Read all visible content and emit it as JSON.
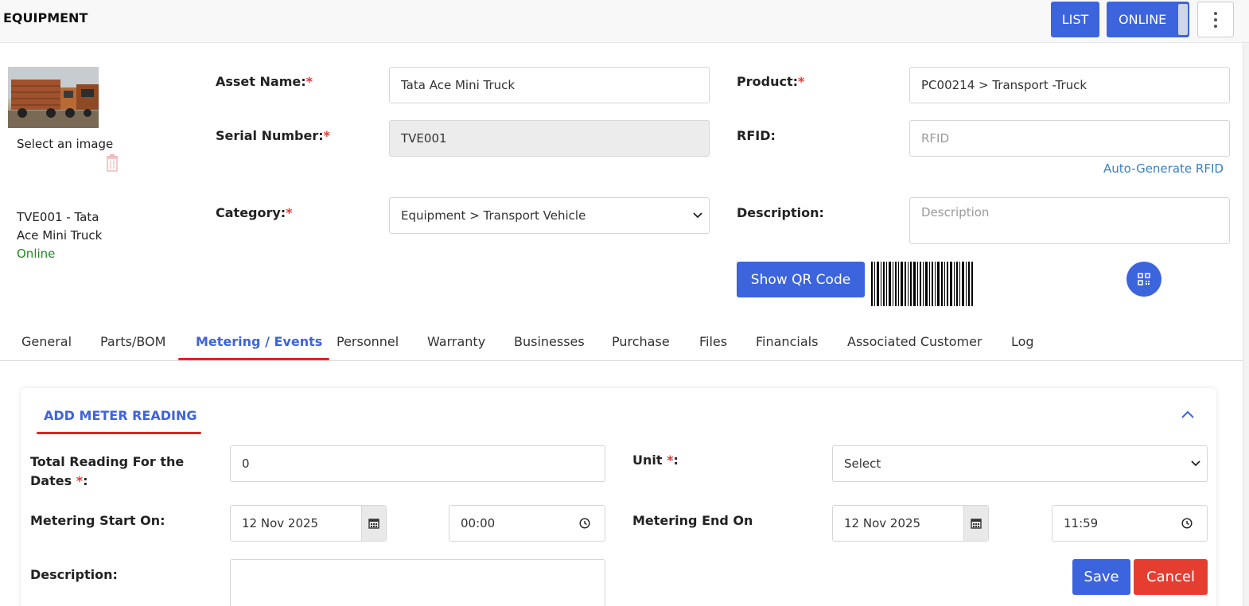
{
  "header": {
    "title": "EQUIPMENT",
    "list_label": "LIST",
    "online_label": "ONLINE"
  },
  "asset": {
    "select_image_label": "Select an image",
    "summary_line1": "TVE001 - Tata",
    "summary_line2": "Ace Mini Truck",
    "status": "Online"
  },
  "form": {
    "asset_name_label": "Asset Name:",
    "asset_name_value": "Tata Ace Mini Truck",
    "serial_label": "Serial Number:",
    "serial_value": "TVE001",
    "category_label": "Category:",
    "category_value": "Equipment > Transport Vehicle",
    "product_label": "Product:",
    "product_value": "PC00214 > Transport -Truck",
    "rfid_label": "RFID:",
    "rfid_placeholder": "RFID",
    "auto_rfid_link": "Auto-Generate RFID",
    "description_label": "Description:",
    "description_placeholder": "Description",
    "show_qr_label": "Show QR Code",
    "required_mark": "*"
  },
  "tabs": [
    {
      "label": "General"
    },
    {
      "label": "Parts/BOM"
    },
    {
      "label": "Metering / Events"
    },
    {
      "label": "Personnel"
    },
    {
      "label": "Warranty"
    },
    {
      "label": "Businesses"
    },
    {
      "label": "Purchase"
    },
    {
      "label": "Files"
    },
    {
      "label": "Financials"
    },
    {
      "label": "Associated Customer"
    },
    {
      "label": "Log"
    }
  ],
  "active_tab": "Metering / Events",
  "meter": {
    "title": "ADD METER READING",
    "total_label_line1": "Total Reading For the",
    "total_label_line2": "Dates",
    "total_value": "0",
    "unit_label": "Unit",
    "unit_value": "Select",
    "start_label": "Metering Start On:",
    "start_date": "12 Nov 2025",
    "start_time": "00:00",
    "end_label": "Metering End On",
    "end_date": "12 Nov 2025",
    "end_time": "11:59",
    "description_label": "Description:",
    "save_label": "Save",
    "cancel_label": "Cancel"
  },
  "colors": {
    "primary": "#3c64dc",
    "danger": "#e53e30",
    "accent_underline": "#e02424",
    "online": "#1f8a1f",
    "link": "#3b7fc4"
  },
  "icons": [
    "more-vertical-icon",
    "trash-icon",
    "qr-code-icon",
    "chevron-down-icon",
    "chevron-up-icon",
    "calendar-icon",
    "clock-icon"
  ]
}
